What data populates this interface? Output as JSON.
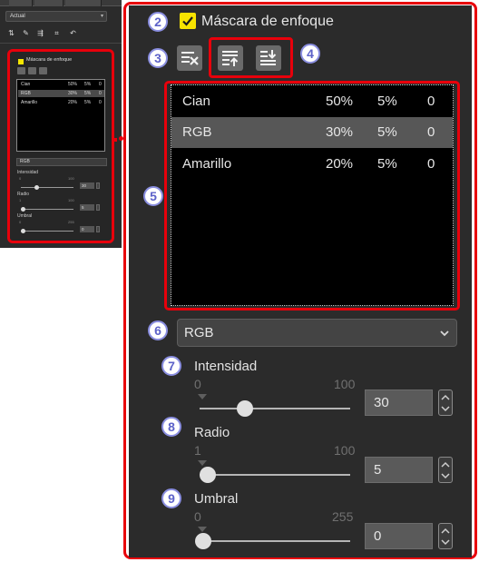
{
  "thumbnail": {
    "preset": "Actual",
    "panel_title": "Máscara de enfoque",
    "rows": [
      {
        "color": "Cian",
        "amount": "50%",
        "radius": "5%",
        "threshold": "0"
      },
      {
        "color": "RGB",
        "amount": "30%",
        "radius": "5%",
        "threshold": "0"
      },
      {
        "color": "Amarillo",
        "amount": "20%",
        "radius": "5%",
        "threshold": "0"
      }
    ],
    "channel": "RGB",
    "intensity_label": "Intensidad",
    "intensity_min": "0",
    "intensity_max": "100",
    "intensity_value": "30",
    "radius_label": "Radio",
    "radius_min": "1",
    "radius_max": "100",
    "radius_value": "5",
    "threshold_label": "Umbral",
    "threshold_min": "0",
    "threshold_max": "255",
    "threshold_value": "0"
  },
  "panel": {
    "title": "Máscara de enfoque",
    "enabled": true,
    "toolbar": {
      "delete_icon": "delete-mask-icon",
      "move_up_icon": "move-up-icon",
      "move_down_icon": "move-down-icon"
    },
    "rows": [
      {
        "color": "Cian",
        "amount": "50%",
        "radius": "5%",
        "threshold": "0",
        "selected": false
      },
      {
        "color": "RGB",
        "amount": "30%",
        "radius": "5%",
        "threshold": "0",
        "selected": true
      },
      {
        "color": "Amarillo",
        "amount": "20%",
        "radius": "5%",
        "threshold": "0",
        "selected": false
      }
    ],
    "channel": "RGB",
    "intensity": {
      "label": "Intensidad",
      "min": "0",
      "max": "100",
      "value": "30"
    },
    "radius": {
      "label": "Radio",
      "min": "1",
      "max": "100",
      "value": "5"
    },
    "threshold": {
      "label": "Umbral",
      "min": "0",
      "max": "255",
      "value": "0"
    }
  },
  "callouts": [
    "2",
    "3",
    "4",
    "5",
    "6",
    "7",
    "8",
    "9"
  ],
  "colors": {
    "highlight": "#e8000b",
    "checkbox": "#f7e300",
    "panel_bg": "#2b2b2b",
    "callout": "#5d62c9"
  }
}
